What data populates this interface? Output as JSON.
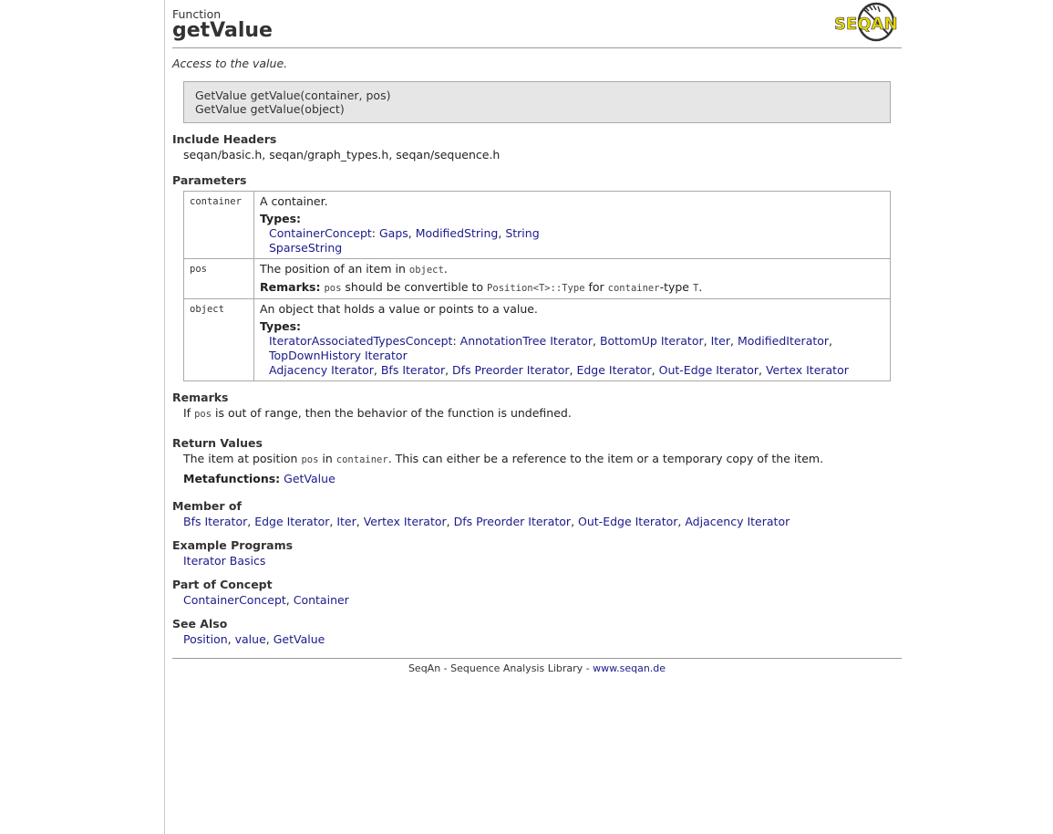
{
  "header": {
    "kind": "Function",
    "title": "getValue",
    "logo_text": "SEQAN"
  },
  "summary": "Access to the value.",
  "signatures": [
    "GetValue getValue(container, pos)",
    "GetValue getValue(object)"
  ],
  "include_headers": {
    "heading": "Include Headers",
    "text": "seqan/basic.h, seqan/graph_types.h, seqan/sequence.h"
  },
  "parameters": {
    "heading": "Parameters",
    "container": {
      "name": "container",
      "desc": "A container.",
      "types_label": "Types:",
      "concept": "ContainerConcept",
      "types_line1": [
        "Gaps",
        "ModifiedString",
        "String"
      ],
      "types_line2": [
        "SparseString"
      ]
    },
    "pos": {
      "name": "pos",
      "desc_pre": "The position of an item in ",
      "desc_code": "object",
      "desc_post": ".",
      "remarks_label": "Remarks:",
      "r_code1": "pos",
      "r_t1": " should be convertible to ",
      "r_code2": "Position<T>::Type",
      "r_t2": " for ",
      "r_code3": "container",
      "r_t3": "-type ",
      "r_code4": "T",
      "r_t4": "."
    },
    "object": {
      "name": "object",
      "desc": "An object that holds a value or points to a value.",
      "types_label": "Types:",
      "concept": "IteratorAssociatedTypesConcept",
      "types_line1": [
        "AnnotationTree Iterator",
        "BottomUp Iterator",
        "Iter",
        "ModifiedIterator"
      ],
      "types_line2": [
        "TopDownHistory Iterator"
      ],
      "types_line3": [
        "Adjacency Iterator",
        "Bfs Iterator",
        "Dfs Preorder Iterator",
        "Edge Iterator",
        "Out-Edge Iterator",
        "Vertex Iterator"
      ]
    }
  },
  "remarks": {
    "heading": "Remarks",
    "t1": "If ",
    "code": "pos",
    "t2": " is out of range, then the behavior of the function is undefined."
  },
  "return_values": {
    "heading": "Return Values",
    "t1": "The item at position ",
    "code1": "pos",
    "t2": " in ",
    "code2": "container",
    "t3": ". This can either be a reference to the item or a temporary copy of the item.",
    "meta_label": "Metafunctions:",
    "meta_link": "GetValue"
  },
  "member_of": {
    "heading": "Member of",
    "links": [
      "Bfs Iterator",
      "Edge Iterator",
      "Iter",
      "Vertex Iterator",
      "Dfs Preorder Iterator",
      "Out-Edge Iterator",
      "Adjacency Iterator"
    ]
  },
  "example_programs": {
    "heading": "Example Programs",
    "links": [
      "Iterator Basics"
    ]
  },
  "part_of_concept": {
    "heading": "Part of Concept",
    "links": [
      "ContainerConcept",
      "Container"
    ]
  },
  "see_also": {
    "heading": "See Also",
    "links": [
      "Position",
      "value",
      "GetValue"
    ]
  },
  "footer": {
    "text": "SeqAn - Sequence Analysis Library - ",
    "link": "www.seqan.de"
  },
  "colors": {
    "link": "#1a1a8c",
    "logo_yellow": "#e8d800",
    "sig_bg": "#e6e6e6"
  }
}
